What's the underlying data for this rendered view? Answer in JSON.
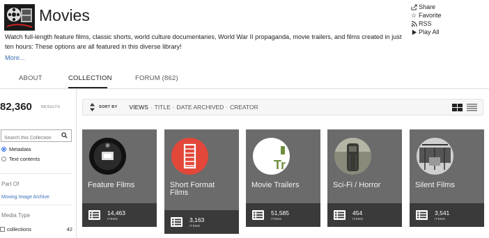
{
  "header": {
    "title": "Movies",
    "description": "Watch full-length feature films, classic shorts, world culture documentaries, World War II propaganda, movie trailers, and films created in just ten hours: These options are all featured in this diverse library!",
    "more_label": "More..."
  },
  "actions": [
    {
      "label": "Share",
      "icon": "share-icon"
    },
    {
      "label": "Favorite",
      "icon": "star-icon"
    },
    {
      "label": "RSS",
      "icon": "rss-icon"
    },
    {
      "label": "Play All",
      "icon": "play-icon"
    }
  ],
  "tabs": [
    {
      "label": "ABOUT",
      "active": false
    },
    {
      "label": "COLLECTION",
      "active": true
    },
    {
      "label": "FORUM (862)",
      "active": false
    }
  ],
  "sidebar": {
    "results_count": "82,360",
    "results_label": "RESULTS",
    "search_placeholder": "Search this Collection",
    "search_options": [
      {
        "label": "Metadata",
        "checked": true
      },
      {
        "label": "Text contents",
        "checked": false
      }
    ],
    "part_of_heading": "Part Of",
    "part_of_link": "Moving Image Archive",
    "media_type_heading": "Media Type",
    "media_types": [
      {
        "label": "collections",
        "count": "42"
      }
    ]
  },
  "sort": {
    "label": "SORT BY",
    "options": [
      {
        "label": "VIEWS",
        "active": true
      },
      {
        "label": "TITLE",
        "active": false
      },
      {
        "label": "DATE ARCHIVED",
        "active": false
      },
      {
        "label": "CREATOR",
        "active": false
      }
    ],
    "separator": "·"
  },
  "cards": [
    {
      "name": "Feature Films",
      "count": "14,463",
      "items_label": "ITEMS",
      "thumb": "film-reel"
    },
    {
      "name": "Short Format Films",
      "count": "3,163",
      "items_label": "ITEMS",
      "thumb": "film-strip"
    },
    {
      "name": "Movie Trailers",
      "count": "51,585",
      "items_label": "ITEMS",
      "thumb": "trailer-logo"
    },
    {
      "name": "Sci-Fi / Horror",
      "count": "454",
      "items_label": "ITEMS",
      "thumb": "robot"
    },
    {
      "name": "Silent Films",
      "count": "3,541",
      "items_label": "ITEMS",
      "thumb": "silent-scene"
    }
  ],
  "colors": {
    "link": "#3b6fb6",
    "card_bg": "#6b6b6b",
    "card_footer": "#3a3a3a",
    "short_film_red": "#e3473a"
  }
}
